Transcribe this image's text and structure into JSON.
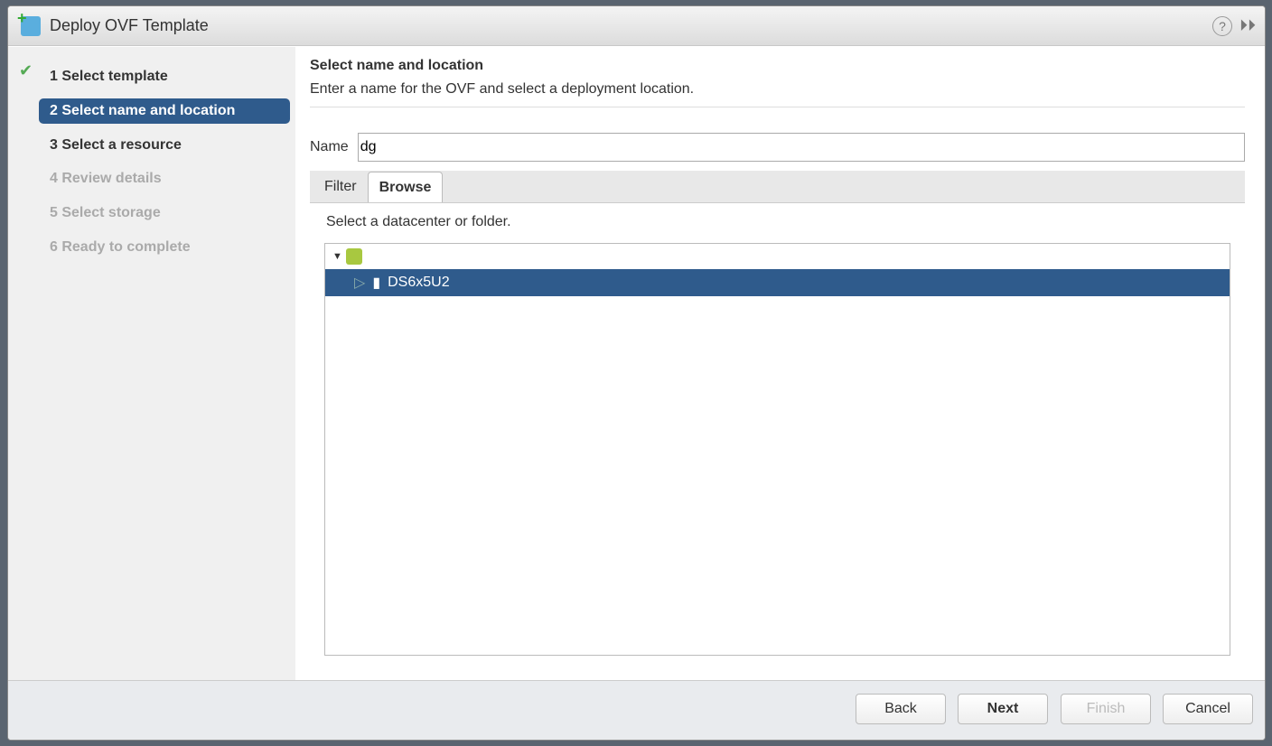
{
  "title": "Deploy OVF Template",
  "steps": [
    "1  Select template",
    "2  Select name and location",
    "3  Select a resource",
    "4  Review details",
    "5  Select storage",
    "6  Ready to complete"
  ],
  "main": {
    "heading": "Select name and location",
    "subtitle": "Enter a name for the OVF and select a deployment location.",
    "name_label": "Name",
    "name_value": "dg",
    "tabs": [
      "Filter",
      "Browse"
    ],
    "hint": "Select a datacenter or folder.",
    "tree": {
      "child": "DS6x5U2"
    }
  },
  "footer": {
    "back": "Back",
    "next": "Next",
    "finish": "Finish",
    "cancel": "Cancel"
  }
}
